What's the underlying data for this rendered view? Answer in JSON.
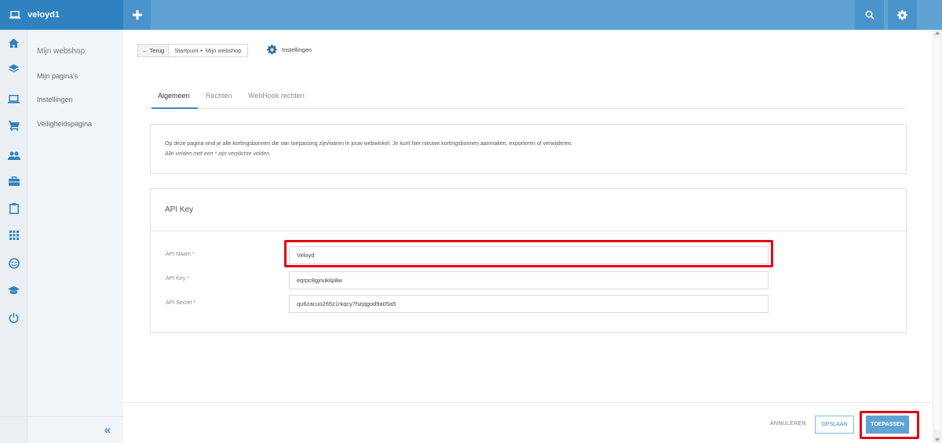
{
  "app": {
    "user_name": "veloyd1",
    "brand_color": "#2f82bf",
    "topbar_color": "#5ea3d3",
    "highlight_color": "#e30613"
  },
  "topbar": {
    "add_icon": "plus-icon",
    "search_icon": "search-icon",
    "settings_icon": "gear-icon"
  },
  "rail": {
    "icons": [
      "home-icon",
      "layers-icon",
      "laptop-icon",
      "cart-icon",
      "users-icon",
      "briefcase-icon",
      "clipboard-icon",
      "grid-icon",
      "smiley-icon",
      "graduation-cap-icon",
      "power-icon"
    ]
  },
  "subnav": {
    "items": [
      "Mijn webshop",
      "Mijn pagina's",
      "Instellingen",
      "Veiligheidspagina"
    ],
    "collapse_label": "«"
  },
  "breadcrumb": {
    "back_label": "← Terug",
    "path": [
      "Startpunt",
      "Mijn webshop"
    ],
    "page_title": "Instellingen"
  },
  "tabs": {
    "items": [
      "Algemeen",
      "Rechten",
      "WebHook rechten"
    ],
    "active_index": 0
  },
  "info": {
    "text": "Op deze pagina vind je alle kortingsbonnen die van toepassing zijn/waren in jouw webwinkel. Je kunt hier nieuwe kortingsbonnen aanmaken, exporteren of verwijderen.",
    "note": "Alle velden met een * zijn verplichte velden."
  },
  "api": {
    "title": "API Key",
    "fields": [
      {
        "label": "API Naam *",
        "value": "Veloyd"
      },
      {
        "label": "API Key *",
        "value": "eqrpc8gjnukilp8w"
      },
      {
        "label": "API Secret *",
        "value": "qu6zacuo265z1rkqcy7hzjqgod9a05a5"
      }
    ]
  },
  "footer": {
    "cancel_label": "ANNULEREN",
    "save_label": "OPSLAAN",
    "apply_label": "TOEPASSEN"
  }
}
